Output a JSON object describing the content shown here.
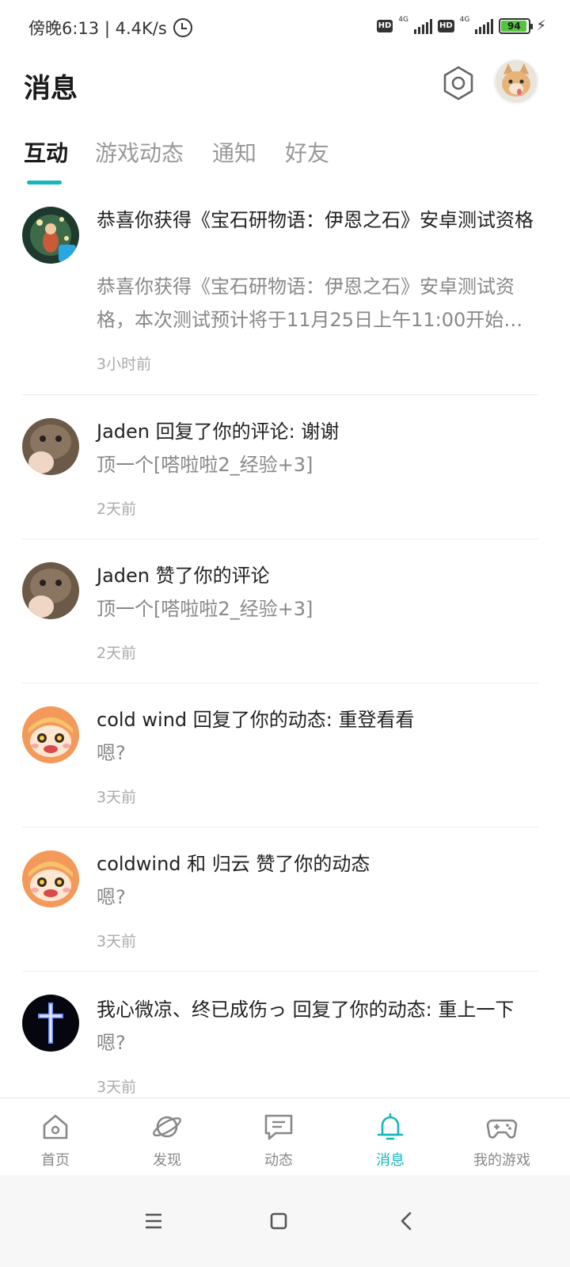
{
  "status_bar": {
    "time_speed": "傍晚6:13 | 4.4K/s",
    "hd1": "HD",
    "net1": "4G",
    "hd2": "HD",
    "net2": "4G",
    "battery": "94"
  },
  "header": {
    "title": "消息"
  },
  "tabs": [
    {
      "label": "互动",
      "active": true
    },
    {
      "label": "游戏动态",
      "active": false
    },
    {
      "label": "通知",
      "active": false
    },
    {
      "label": "好友",
      "active": false
    }
  ],
  "messages": [
    {
      "title": "恭喜你获得《宝石研物语：伊恩之石》安卓测试资格",
      "body": "恭喜你获得《宝石研物语：伊恩之石》安卓测试资格，本次测试预计将于11月25日上午11:00开始…",
      "time": "3小时前"
    },
    {
      "title": "Jaden 回复了你的评论: 谢谢",
      "body": "顶一个[嗒啦啦2_经验+3]",
      "time": "2天前"
    },
    {
      "title": "Jaden 赞了你的评论",
      "body": "顶一个[嗒啦啦2_经验+3]",
      "time": "2天前"
    },
    {
      "title": "cold wind 回复了你的动态: 重登看看",
      "body": "嗯?",
      "time": "3天前"
    },
    {
      "title": "coldwind 和 归云 赞了你的动态",
      "body": "嗯?",
      "time": "3天前"
    },
    {
      "title": "我心微凉、终已成伤っ 回复了你的动态: 重上一下",
      "body": "嗯?",
      "time": "3天前"
    }
  ],
  "bottom_nav": [
    {
      "label": "首页",
      "icon": "home-icon"
    },
    {
      "label": "发现",
      "icon": "planet-icon"
    },
    {
      "label": "动态",
      "icon": "chat-icon"
    },
    {
      "label": "消息",
      "icon": "bell-icon",
      "active": true
    },
    {
      "label": "我的游戏",
      "icon": "gamepad-icon"
    }
  ],
  "colors": {
    "accent": "#15b5c0",
    "inactive": "#888888"
  }
}
